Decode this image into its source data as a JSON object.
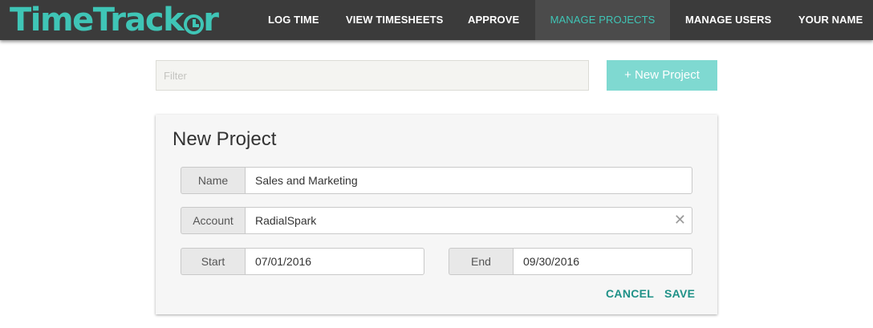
{
  "brand": {
    "logo_text_start": "TimeTrack",
    "logo_text_end": "r",
    "logo_icon": "clock-icon"
  },
  "nav": {
    "items": [
      {
        "label": "LOG TIME"
      },
      {
        "label": "VIEW TIMESHEETS"
      },
      {
        "label": "APPROVE"
      },
      {
        "label": "MANAGE PROJECTS",
        "active": true
      },
      {
        "label": "MANAGE USERS"
      },
      {
        "label": "YOUR NAME",
        "has_dropdown": true
      }
    ]
  },
  "filter": {
    "placeholder": "Filter",
    "value": ""
  },
  "new_project_button": {
    "label": "+ New Project"
  },
  "form": {
    "title": "New Project",
    "fields": {
      "name": {
        "label": "Name",
        "value": "Sales and Marketing"
      },
      "account": {
        "label": "Account",
        "value": "RadialSpark",
        "clear_icon": "close-icon"
      },
      "start": {
        "label": "Start",
        "value": "07/01/2016"
      },
      "end": {
        "label": "End",
        "value": "09/30/2016"
      }
    },
    "actions": {
      "cancel": "CANCEL",
      "save": "SAVE"
    }
  },
  "colors": {
    "nav_bg": "#3b3b3b",
    "nav_active_bg": "#4b4b4b",
    "accent": "#3fc5b6",
    "button_bg": "#7fd9d1",
    "action_text": "#1e9187"
  }
}
